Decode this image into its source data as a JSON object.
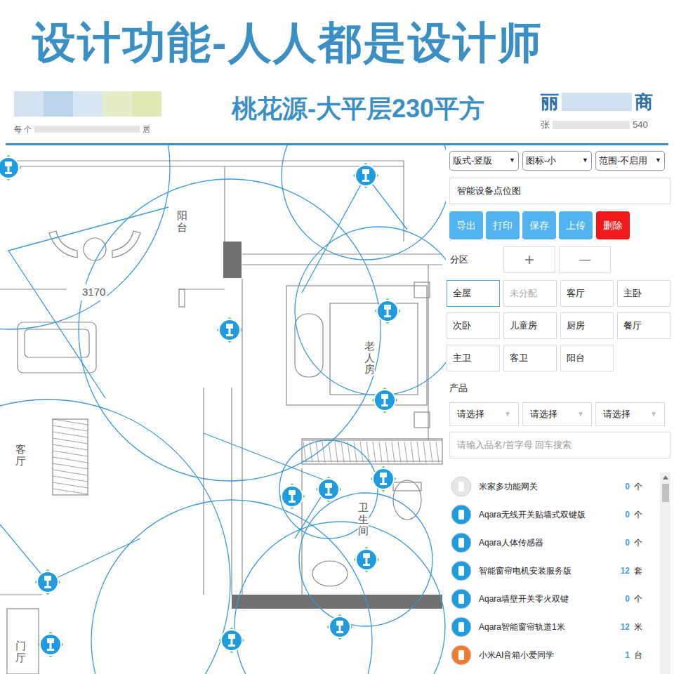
{
  "banner": {
    "title": "设计功能-人人都是设计师"
  },
  "header": {
    "project": "桃花源-大平层230平方",
    "left_caption_start": "每 个",
    "left_caption_end": "居",
    "right_title_start": "丽",
    "right_title_end": "商",
    "right_caption_start": "张",
    "right_caption_end": "540"
  },
  "plan": {
    "dimension": "3170",
    "rooms": [
      {
        "label": "阳台"
      },
      {
        "label": "老人房"
      },
      {
        "label": "卫生间"
      },
      {
        "label": "客厅"
      },
      {
        "label": "门厅"
      }
    ]
  },
  "toolbar": {
    "selects": [
      "版式-竖版",
      "图标-小",
      "范围-不启用"
    ],
    "select_arrow": "▼",
    "title_field": "智能设备点位图",
    "buttons": [
      {
        "label": "导出",
        "kind": "primary"
      },
      {
        "label": "打印",
        "kind": "primary"
      },
      {
        "label": "保存",
        "kind": "primary"
      },
      {
        "label": "上传",
        "kind": "primary"
      },
      {
        "label": "删除",
        "kind": "danger"
      }
    ]
  },
  "zones": {
    "label": "分区",
    "add": "+",
    "remove": "—",
    "items": [
      {
        "label": "全屋",
        "selected": true,
        "disabled": false
      },
      {
        "label": "未分配",
        "selected": false,
        "disabled": true
      },
      {
        "label": "客厅",
        "selected": false,
        "disabled": false
      },
      {
        "label": "主卧",
        "selected": false,
        "disabled": false
      },
      {
        "label": "次卧",
        "selected": false,
        "disabled": false
      },
      {
        "label": "儿童房",
        "selected": false,
        "disabled": false
      },
      {
        "label": "厨房",
        "selected": false,
        "disabled": false
      },
      {
        "label": "餐厅",
        "selected": false,
        "disabled": false
      },
      {
        "label": "主卫",
        "selected": false,
        "disabled": false
      },
      {
        "label": "客卫",
        "selected": false,
        "disabled": false
      },
      {
        "label": "阳台",
        "selected": false,
        "disabled": false
      }
    ]
  },
  "products": {
    "label": "产品",
    "filters": [
      "请选择",
      "请选择",
      "请选择"
    ],
    "filter_arrow": "▼",
    "search_placeholder": "请输入品名/首字母 回车搜索",
    "items": [
      {
        "name": "米家多功能网关",
        "count": "0",
        "unit": "个",
        "color": "#e6e6e6"
      },
      {
        "name": "Aqara无线开关贴墙式双键版",
        "count": "0",
        "unit": "个",
        "color": "#1f9be0"
      },
      {
        "name": "Aqara人体传感器",
        "count": "0",
        "unit": "个",
        "color": "#1f9be0"
      },
      {
        "name": "智能窗帘电机安装服务版",
        "count": "12",
        "unit": "套",
        "color": "#1f9be0"
      },
      {
        "name": "Aqara墙壁开关零火双键",
        "count": "0",
        "unit": "个",
        "color": "#1f9be0"
      },
      {
        "name": "Aqara智能窗帘轨道1米",
        "count": "12",
        "unit": "米",
        "color": "#1f9be0"
      },
      {
        "name": "小米AI音箱小爱同学",
        "count": "1",
        "unit": "台",
        "color": "#f07a32"
      }
    ]
  }
}
